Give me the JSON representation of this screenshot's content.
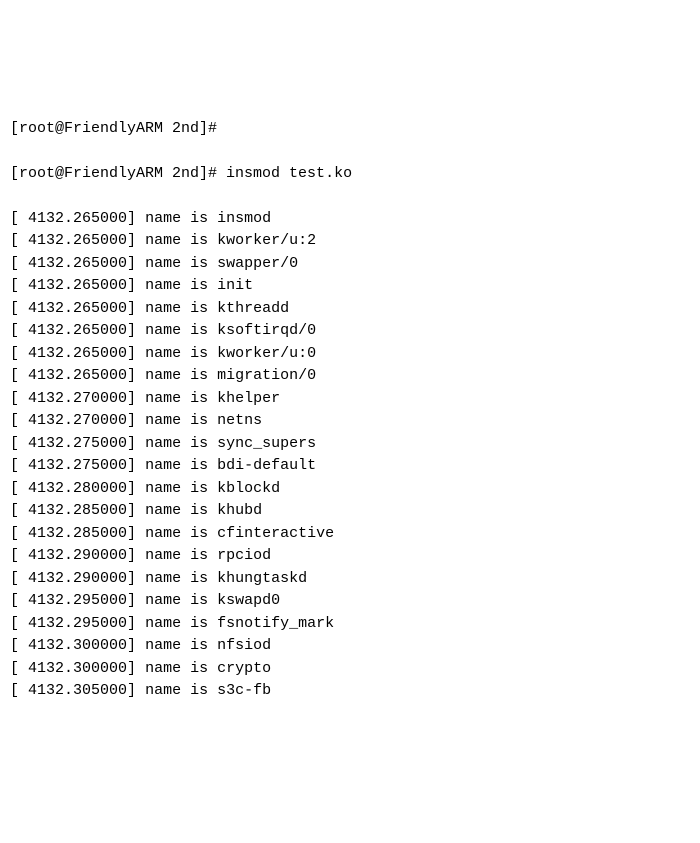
{
  "prompt1": "[root@FriendlyARM 2nd]#",
  "prompt2": "[root@FriendlyARM 2nd]# ",
  "command": "insmod test.ko",
  "log_prefix": "name is",
  "logs": [
    {
      "ts": "4132.265000",
      "name": "insmod"
    },
    {
      "ts": "4132.265000",
      "name": "kworker/u:2"
    },
    {
      "ts": "4132.265000",
      "name": "swapper/0"
    },
    {
      "ts": "4132.265000",
      "name": "init"
    },
    {
      "ts": "4132.265000",
      "name": "kthreadd"
    },
    {
      "ts": "4132.265000",
      "name": "ksoftirqd/0"
    },
    {
      "ts": "4132.265000",
      "name": "kworker/u:0"
    },
    {
      "ts": "4132.265000",
      "name": "migration/0"
    },
    {
      "ts": "4132.270000",
      "name": "khelper"
    },
    {
      "ts": "4132.270000",
      "name": "netns"
    },
    {
      "ts": "4132.275000",
      "name": "sync_supers"
    },
    {
      "ts": "4132.275000",
      "name": "bdi-default"
    },
    {
      "ts": "4132.280000",
      "name": "kblockd"
    },
    {
      "ts": "4132.285000",
      "name": "khubd"
    },
    {
      "ts": "4132.285000",
      "name": "cfinteractive"
    },
    {
      "ts": "4132.290000",
      "name": "rpciod"
    },
    {
      "ts": "4132.290000",
      "name": "khungtaskd"
    },
    {
      "ts": "4132.295000",
      "name": "kswapd0"
    },
    {
      "ts": "4132.295000",
      "name": "fsnotify_mark"
    },
    {
      "ts": "4132.300000",
      "name": "nfsiod"
    },
    {
      "ts": "4132.300000",
      "name": "crypto"
    },
    {
      "ts": "4132.305000",
      "name": "s3c-fb"
    }
  ]
}
